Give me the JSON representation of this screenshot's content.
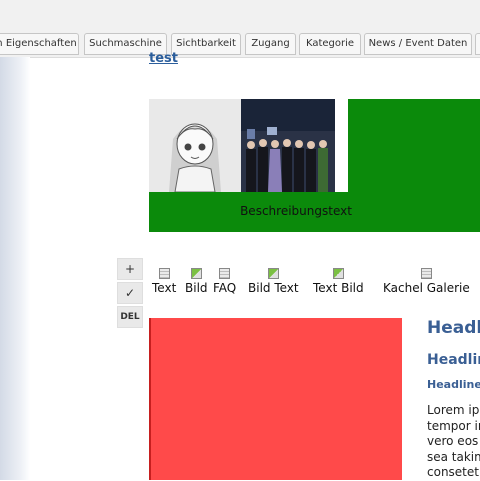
{
  "tabs": [
    {
      "label": "n Eigenschaften"
    },
    {
      "label": "Suchmaschine"
    },
    {
      "label": "Sichtbarkeit"
    },
    {
      "label": "Zugang"
    },
    {
      "label": "Kategorie"
    },
    {
      "label": "News / Event Daten"
    }
  ],
  "content": {
    "link_text": "test",
    "gallery_caption": "Beschreibungstext",
    "headline_1": "Headl",
    "headline_2": "Headlin",
    "headline_3": "Headline",
    "lorem_lines": [
      "Lorem ips",
      "tempor in",
      "vero eos e",
      "sea takim",
      "consetetu"
    ]
  },
  "tools": {
    "add": "+",
    "check": "✓",
    "del": "DEL"
  },
  "content_types": [
    {
      "label": "Text",
      "icon": "text-icon"
    },
    {
      "label": "Bild",
      "icon": "image-icon"
    },
    {
      "label": "FAQ",
      "icon": "faq-icon"
    },
    {
      "label": "Bild Text",
      "icon": "image-text-icon"
    },
    {
      "label": "Text Bild",
      "icon": "text-image-icon"
    },
    {
      "label": "Kachel Galerie",
      "icon": "tile-gallery-icon"
    }
  ],
  "colors": {
    "gallery_bg": "#0b8a0b",
    "red_block": "#ff4a4a",
    "headline": "#3a5f94",
    "link": "#2b5e9c"
  }
}
